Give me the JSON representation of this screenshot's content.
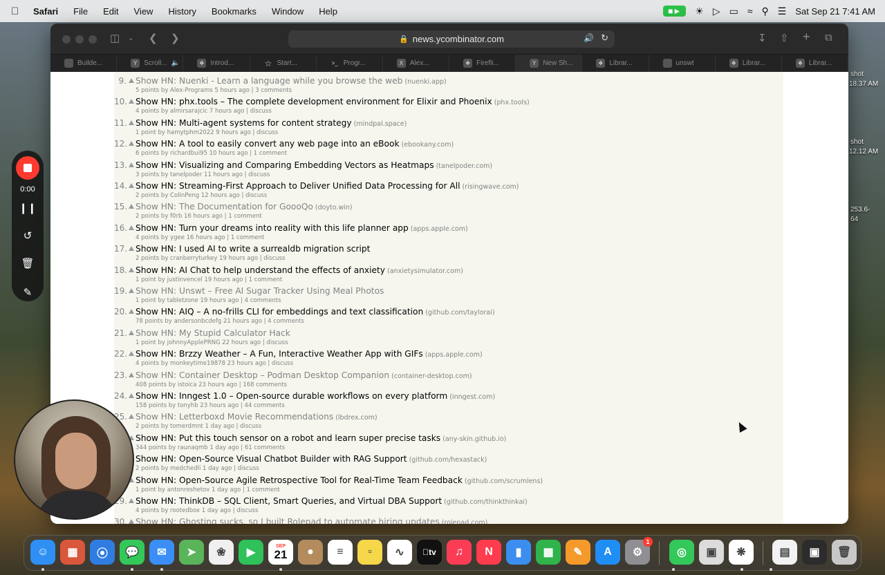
{
  "menubar": {
    "app_name": "Safari",
    "menus": [
      "File",
      "Edit",
      "View",
      "History",
      "Bookmarks",
      "Window",
      "Help"
    ],
    "datetime": "Sat Sep 21  7:41 AM"
  },
  "desktop_labels": [
    "shot",
    "18.37 AM",
    "shot",
    "12.12 AM",
    "253.6-",
    "64"
  ],
  "browser": {
    "url": "news.ycombinator.com",
    "tabs": [
      {
        "label": "Builde...",
        "icon": "app-icon",
        "active": false
      },
      {
        "label": "Scroll...",
        "icon": "y-icon",
        "active": false
      },
      {
        "label": "Introd...",
        "icon": "grid-icon",
        "active": false
      },
      {
        "label": "Start...",
        "icon": "star-icon",
        "active": false
      },
      {
        "label": "Progr...",
        "icon": "terminal-icon",
        "active": false
      },
      {
        "label": "Alex...",
        "icon": "x-icon",
        "active": false
      },
      {
        "label": "Firefli...",
        "icon": "grid-icon",
        "active": false
      },
      {
        "label": "New Sh...",
        "icon": "y-icon",
        "active": true
      },
      {
        "label": "Librar...",
        "icon": "grid-icon",
        "active": false
      },
      {
        "label": "unswt",
        "icon": "app-icon",
        "active": false
      },
      {
        "label": "Librar...",
        "icon": "grid-icon",
        "active": false
      },
      {
        "label": "Librar...",
        "icon": "grid-icon",
        "active": false
      }
    ]
  },
  "stories": [
    {
      "rank": "9.",
      "title": "Show HN: Nuenki - Learn a language while you browse the web",
      "site": "(nuenki.app)",
      "sub": "5 points by Alex-Programs 5 hours ago | 3 comments",
      "visited": true
    },
    {
      "rank": "10.",
      "title": "Show HN: phx.tools – The complete development environment for Elixir and Phoenix",
      "site": "(phx.tools)",
      "sub": "4 points by almirsarajcic 7 hours ago | discuss",
      "visited": false
    },
    {
      "rank": "11.",
      "title": "Show HN: Multi-agent systems for content strategy",
      "site": "(mindpal.space)",
      "sub": "1 point by hamytphm2022 9 hours ago | discuss",
      "visited": false
    },
    {
      "rank": "12.",
      "title": "Show HN: A tool to easily convert any web page into an eBook",
      "site": "(ebookany.com)",
      "sub": "6 points by richardbui95 10 hours ago | 1 comment",
      "visited": false
    },
    {
      "rank": "13.",
      "title": "Show HN: Visualizing and Comparing Embedding Vectors as Heatmaps",
      "site": "(tanelpoder.com)",
      "sub": "3 points by tanelpoder 11 hours ago | discuss",
      "visited": false
    },
    {
      "rank": "14.",
      "title": "Show HN: Streaming-First Approach to Deliver Unified Data Processing for All",
      "site": "(risingwave.com)",
      "sub": "2 points by ColinPeng 12 hours ago | discuss",
      "visited": false
    },
    {
      "rank": "15.",
      "title": "Show HN: The Documentation for GoooQo",
      "site": "(doyto.win)",
      "sub": "2 points by f0rb 16 hours ago | 1 comment",
      "visited": true
    },
    {
      "rank": "16.",
      "title": "Show HN: Turn your dreams into reality with this life planner app",
      "site": "(apps.apple.com)",
      "sub": "4 points by ygee 16 hours ago | 1 comment",
      "visited": false
    },
    {
      "rank": "17.",
      "title": "Show HN: I used AI to write a surrealdb migration script",
      "site": "",
      "sub": "2 points by cranberryturkey 19 hours ago | discuss",
      "visited": false
    },
    {
      "rank": "18.",
      "title": "Show HN: AI Chat to help understand the effects of anxiety",
      "site": "(anxietysimulator.com)",
      "sub": "1 point by justinvencel 19 hours ago | 1 comment",
      "visited": false
    },
    {
      "rank": "19.",
      "title": "Show HN: Unswt – Free AI Sugar Tracker Using Meal Photos",
      "site": "",
      "sub": "1 point by tabletzone 19 hours ago | 4 comments",
      "visited": true
    },
    {
      "rank": "20.",
      "title": "Show HN: AIQ – A no-frills CLI for embeddings and text classification",
      "site": "(github.com/taylorai)",
      "sub": "78 points by andersonbcdefg 21 hours ago | 4 comments",
      "visited": false
    },
    {
      "rank": "21.",
      "title": "Show HN: My Stupid Calculator Hack",
      "site": "",
      "sub": "1 point by johnnyApplePRNG 22 hours ago | discuss",
      "visited": true
    },
    {
      "rank": "22.",
      "title": "Show HN: Brzzy Weather – A Fun, Interactive Weather App with GIFs",
      "site": "(apps.apple.com)",
      "sub": "4 points by monkeytime19878 23 hours ago | discuss",
      "visited": false
    },
    {
      "rank": "23.",
      "title": "Show HN: Container Desktop – Podman Desktop Companion",
      "site": "(container-desktop.com)",
      "sub": "408 points by istoica 23 hours ago | 168 comments",
      "visited": true
    },
    {
      "rank": "24.",
      "title": "Show HN: Inngest 1.0 – Open-source durable workflows on every platform",
      "site": "(inngest.com)",
      "sub": "158 points by tonyhb 23 hours ago | 44 comments",
      "visited": false
    },
    {
      "rank": "25.",
      "title": "Show HN: Letterboxd Movie Recommendations",
      "site": "(lbdrex.com)",
      "sub": "2 points by tomerdmnt 1 day ago | discuss",
      "visited": true
    },
    {
      "rank": "26.",
      "title": "Show HN: Put this touch sensor on a robot and learn super precise tasks",
      "site": "(any-skin.github.io)",
      "sub": "344 points by raunaqmb 1 day ago | 61 comments",
      "visited": false
    },
    {
      "rank": "27.",
      "title": "Show HN: Open-Source Visual Chatbot Builder with RAG Support",
      "site": "(github.com/hexastack)",
      "sub": "2 points by medchedli 1 day ago | discuss",
      "visited": false
    },
    {
      "rank": "28.",
      "title": "Show HN: Open-Source Agile Retrospective Tool for Real-Time Team Feedback",
      "site": "(github.com/scrumlens)",
      "sub": "1 point by antonreshetov 1 day ago | 1 comment",
      "visited": false
    },
    {
      "rank": "29.",
      "title": "Show HN: ThinkDB – SQL Client, Smart Queries, and Virtual DBA Support",
      "site": "(github.com/thinkthinkai)",
      "sub": "4 points by rootedbox 1 day ago | discuss",
      "visited": false
    },
    {
      "rank": "30.",
      "title": "Show HN: Ghosting sucks, so I built Rolepad to automate hiring updates",
      "site": "(rolepad.com)",
      "sub": "",
      "visited": true
    }
  ],
  "recorder": {
    "elapsed": "0:00"
  },
  "dock": {
    "calendar_month": "SEP",
    "calendar_day": "21",
    "settings_badge": "1",
    "tv_label": "tv",
    "apps": [
      {
        "name": "finder-icon",
        "color": "#2f8ff5"
      },
      {
        "name": "launchpad-icon",
        "color": "#d9573b"
      },
      {
        "name": "safari-icon",
        "color": "#2f7de0"
      },
      {
        "name": "messages-icon",
        "color": "#34c759"
      },
      {
        "name": "mail-icon",
        "color": "#3a8ef5"
      },
      {
        "name": "maps-icon",
        "color": "#5ab55a"
      },
      {
        "name": "photos-icon",
        "color": "#f0f0f0"
      },
      {
        "name": "facetime-icon",
        "color": "#2fc15a"
      },
      {
        "name": "calendar-icon",
        "color": "#ffffff"
      },
      {
        "name": "contacts-icon",
        "color": "#b38b5d"
      },
      {
        "name": "reminders-icon",
        "color": "#ffffff"
      },
      {
        "name": "notes-icon",
        "color": "#f7d74a"
      },
      {
        "name": "freeform-icon",
        "color": "#ffffff"
      },
      {
        "name": "tv-icon",
        "color": "#111111"
      },
      {
        "name": "music-icon",
        "color": "#fa3d55"
      },
      {
        "name": "news-icon",
        "color": "#ff3b4e"
      },
      {
        "name": "keynote-icon",
        "color": "#3b8ef0"
      },
      {
        "name": "numbers-icon",
        "color": "#2fb34a"
      },
      {
        "name": "pages-icon",
        "color": "#f59a2a"
      },
      {
        "name": "app-store-icon",
        "color": "#1f8ef5"
      },
      {
        "name": "system-settings-icon",
        "color": "#8e8e93"
      },
      {
        "name": "find-my-icon",
        "color": "#34c759"
      },
      {
        "name": "preview-icon",
        "color": "#dcdcdc"
      },
      {
        "name": "perplexity-icon",
        "color": "#ffffff"
      },
      {
        "name": "document-icon",
        "color": "#f2f2f2"
      },
      {
        "name": "screenshot-folder-icon",
        "color": "#2c2c2c"
      },
      {
        "name": "trash-icon",
        "color": "#c8c8c8"
      }
    ]
  }
}
